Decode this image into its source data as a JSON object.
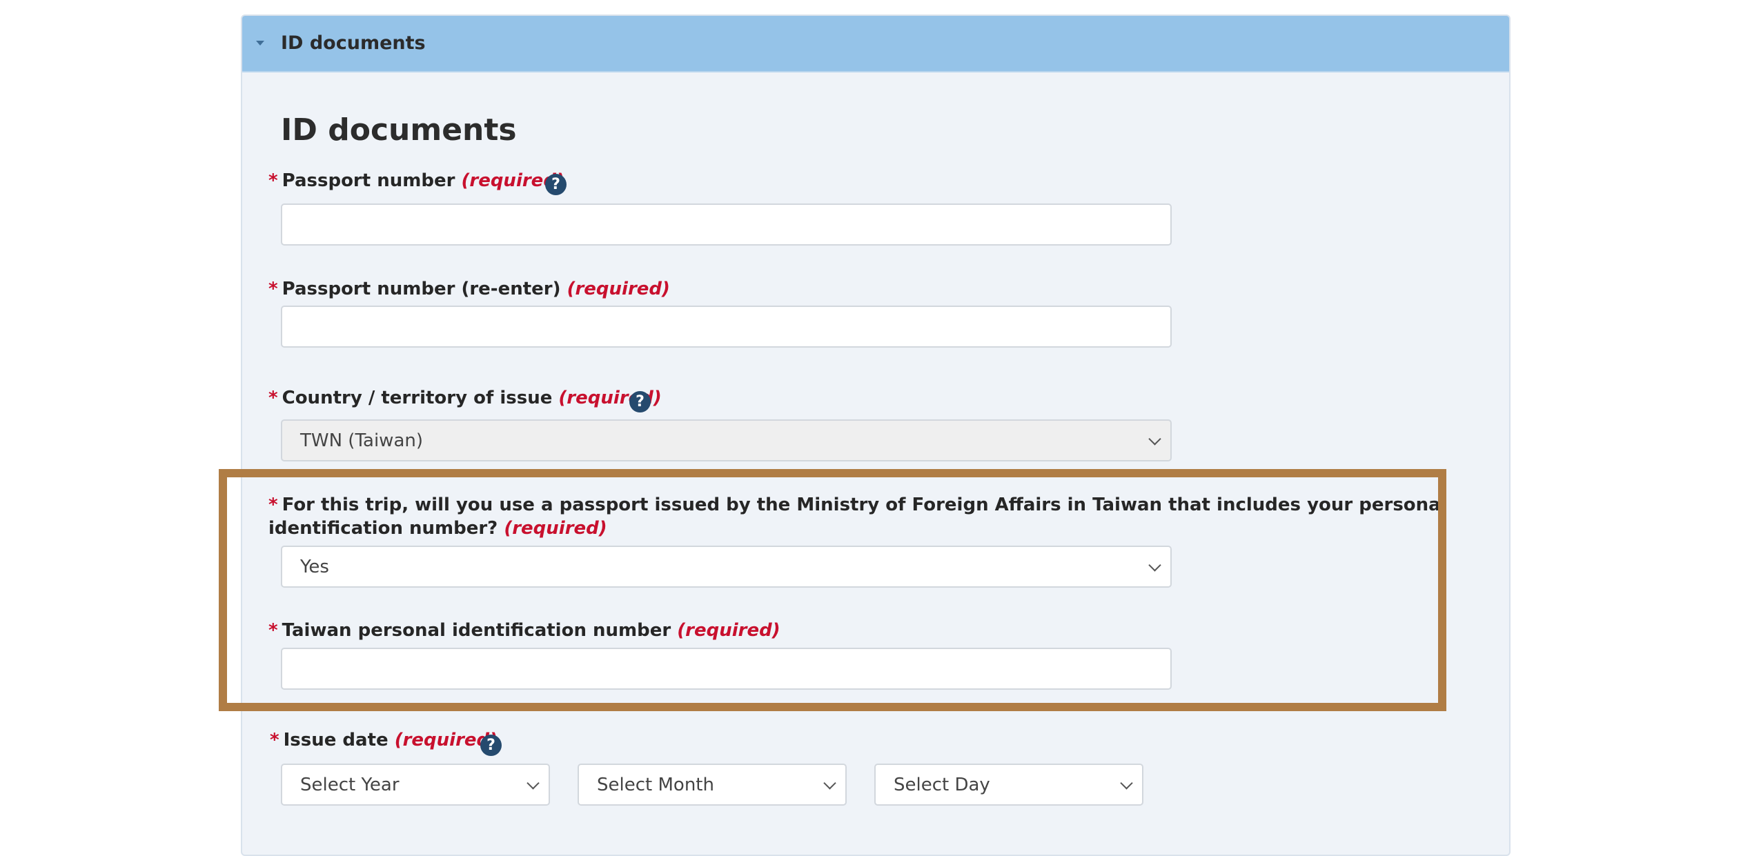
{
  "panel": {
    "header_title": "ID documents"
  },
  "section": {
    "title": "ID documents"
  },
  "colors": {
    "header_bg": "#95c3e8",
    "panel_bg": "#eff3f8",
    "required_red": "#c8102e",
    "help_icon": "#254a6e",
    "highlight_border": "#b07d45"
  },
  "fields": {
    "passport_number": {
      "label": "Passport number",
      "required": "(required)",
      "value": "",
      "help_icon": "question-circle-icon"
    },
    "passport_number_reenter": {
      "label": "Passport number (re-enter)",
      "required": "(required)",
      "value": ""
    },
    "country_of_issue": {
      "label": "Country / territory of issue",
      "required": "(required)",
      "selected": "TWN (Taiwan)",
      "help_icon": "question-circle-icon"
    },
    "taiwan_passport_question": {
      "label": "For this trip, will you use a passport issued by the Ministry of Foreign Affairs in Taiwan that includes your personal identification number?",
      "required": "(required)",
      "selected": "Yes"
    },
    "taiwan_id_number": {
      "label": "Taiwan personal identification number",
      "required": "(required)",
      "value": ""
    },
    "issue_date": {
      "label": "Issue date",
      "required": "(required)",
      "help_icon": "question-circle-icon",
      "year": "Select Year",
      "month": "Select Month",
      "day": "Select Day"
    }
  },
  "star": "*",
  "help_glyph": "?"
}
